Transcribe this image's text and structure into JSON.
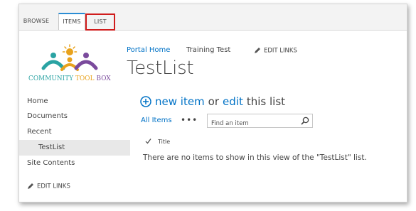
{
  "ribbon": {
    "tabs": [
      {
        "label": "BROWSE"
      },
      {
        "label": "ITEMS"
      },
      {
        "label": "LIST"
      }
    ]
  },
  "logo": {
    "word1": "COMMUNITY",
    "word2": "TOOL",
    "word3": "BOX",
    "colors": {
      "teal": "#2aa3a3",
      "orange": "#e8a21c",
      "purple": "#7a4a9c",
      "green": "#3aaa35"
    }
  },
  "top_nav": {
    "portal_home": "Portal Home",
    "training_test": "Training Test",
    "edit_links": "EDIT LINKS"
  },
  "page": {
    "title": "TestList"
  },
  "quick_launch": {
    "items": [
      {
        "label": "Home"
      },
      {
        "label": "Documents"
      },
      {
        "label": "Recent"
      },
      {
        "label": "TestList"
      },
      {
        "label": "Site Contents"
      }
    ],
    "edit_links": "EDIT LINKS"
  },
  "list": {
    "new_item_link": "new item",
    "or_text": "or",
    "edit_link": "edit",
    "this_list_text": "this list",
    "view_name": "All Items",
    "more_menu": "•••",
    "search_placeholder": "Find an item",
    "column_title": "Title",
    "empty_message": "There are no items to show in this view of the \"TestList\" list."
  },
  "colors": {
    "accent_blue": "#0072c6",
    "highlight_red": "#d01c1c",
    "tab_blue": "#2a8dd4"
  }
}
